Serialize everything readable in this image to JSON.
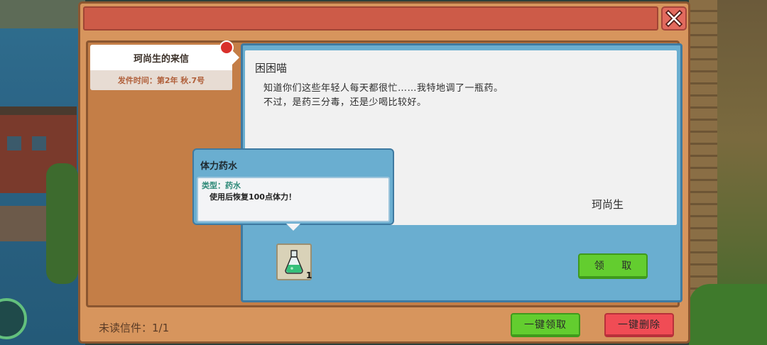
{
  "mail_list": {
    "items": [
      {
        "title": "珂尚生的来信",
        "date": "发件时间：第2年 秋.7号",
        "unread": true
      }
    ]
  },
  "letter": {
    "greeting": "困困喵",
    "lines": [
      "知道你们这些年轻人每天都很忙……我特地调了一瓶药。",
      "不过，是药三分毒，还是少喝比较好。"
    ],
    "signature": "珂尚生"
  },
  "tooltip": {
    "name": "体力药水",
    "type": "类型：药水",
    "description": "使用后恢复100点体力！"
  },
  "attachment": {
    "icon": "potion-flask-icon",
    "count": "1"
  },
  "buttons": {
    "claim": "领 取",
    "claim_all": "一键领取",
    "delete_all": "一键删除",
    "close": "close-icon"
  },
  "footer": {
    "unread": "未读信件：1/1"
  },
  "colors": {
    "panel": "#d7955d",
    "title_bar": "#cd5b48",
    "content_blue": "#6aaed0",
    "green_button": "#63cd2f",
    "red_button": "#f04c55",
    "unread_dot": "#d9302b"
  }
}
